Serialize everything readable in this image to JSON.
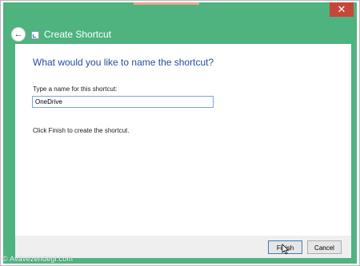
{
  "window": {
    "title": "Create Shortcut",
    "close_label": "✕"
  },
  "wizard": {
    "heading": "What would you like to name the shortcut?",
    "field_label": "Type a name for this shortcut:",
    "name_value": "OneDrive",
    "finish_instruction": "Click Finish to create the shortcut."
  },
  "buttons": {
    "finish_label": "Finish",
    "cancel_label": "Cancel"
  },
  "watermark": {
    "text": "© Avavezendegi.com"
  },
  "icons": {
    "back": "back-arrow-icon",
    "shortcut": "shortcut-icon",
    "cursor": "mouse-cursor-icon"
  },
  "colors": {
    "window_frame": "#4fb37f",
    "heading": "#1f4ea3",
    "close_button": "#c7463a"
  }
}
